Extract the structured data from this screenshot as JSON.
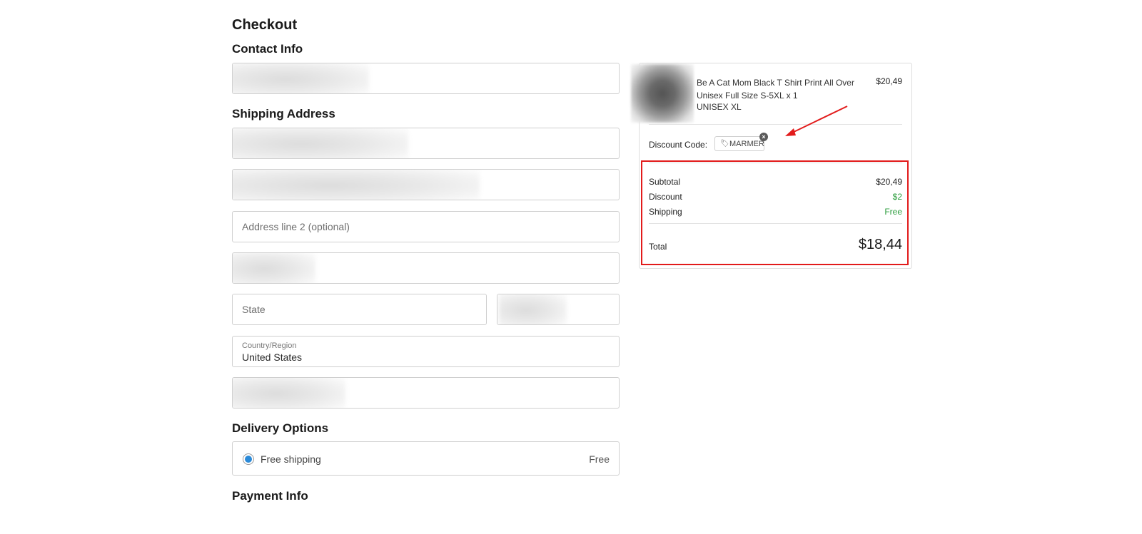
{
  "checkout": {
    "title": "Checkout",
    "contact_title": "Contact Info",
    "shipping_title": "Shipping Address",
    "address2_placeholder": "Address line 2 (optional)",
    "state_placeholder": "State",
    "country_label": "Country/Region",
    "country_value": "United States",
    "delivery_title": "Delivery Options",
    "delivery_option_label": "Free shipping",
    "delivery_option_price": "Free",
    "payment_title": "Payment Info"
  },
  "summary": {
    "product_name": "Be A Cat Mom Black T Shirt Print All Over Unisex Full Size S-5XL x 1",
    "product_variant": "UNISEX XL",
    "product_price": "$20,49",
    "discount_label": "Discount Code:",
    "discount_code": "MARMER",
    "subtotal_label": "Subtotal",
    "subtotal_value": "$20,49",
    "discount_row_label": "Discount",
    "discount_value": "$2",
    "shipping_label": "Shipping",
    "shipping_value": "Free",
    "total_label": "Total",
    "total_value": "$18,44"
  },
  "icons": {
    "tag": "tag-icon",
    "remove": "close-icon",
    "radio": "radio-selected-icon"
  },
  "colors": {
    "accent_blue": "#2b8ad8",
    "discount_green": "#2e9e3f",
    "highlight_red": "#e21b1b"
  }
}
